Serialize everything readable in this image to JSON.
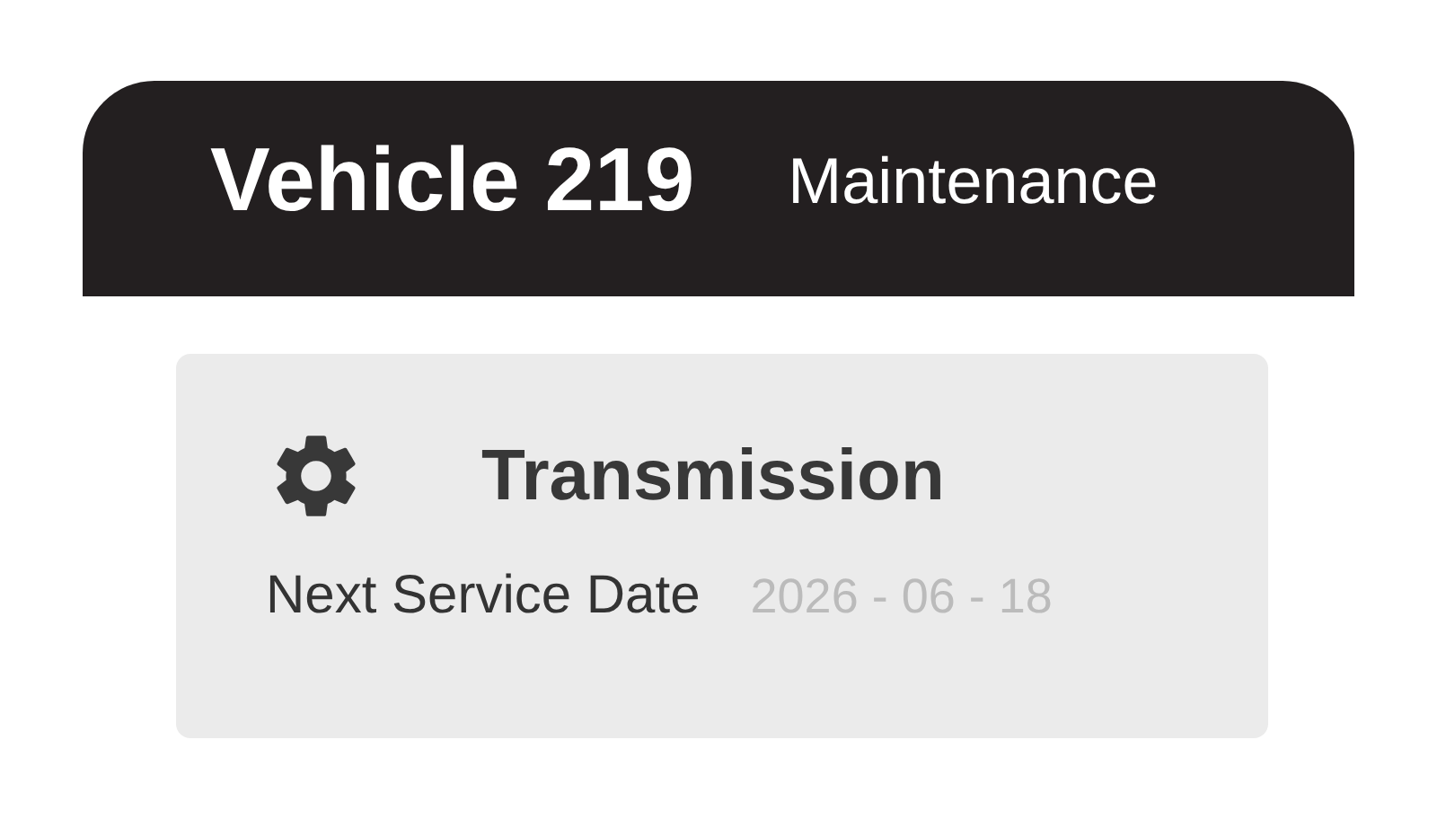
{
  "header": {
    "title": "Vehicle 219",
    "subtitle": "Maintenance"
  },
  "card": {
    "title": "Transmission",
    "label": "Next Service Date",
    "value": "2026 - 06 - 18"
  }
}
